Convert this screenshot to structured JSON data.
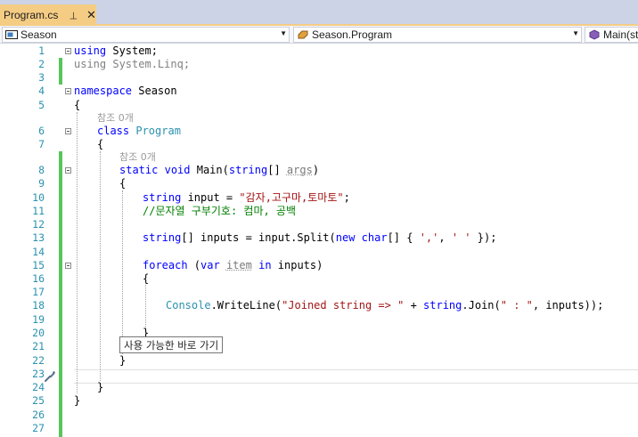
{
  "tab": {
    "title": "Program.cs",
    "pin_glyph": "⊣",
    "close_glyph": "✕",
    "active_color": "#f5cc84"
  },
  "navigation": {
    "project": "Season",
    "type": "Season.Program",
    "member": "Main(st"
  },
  "code_lens": {
    "references_0": "참조 0개"
  },
  "tooltip": "사용 가능한 바로 가기",
  "line_numbers": [
    "1",
    "2",
    "3",
    "4",
    "5",
    "6",
    "7",
    "8",
    "9",
    "10",
    "11",
    "12",
    "13",
    "14",
    "15",
    "16",
    "17",
    "18",
    "19",
    "20",
    "21",
    "22",
    "23",
    "24",
    "25",
    "26",
    "27"
  ],
  "code": {
    "l1_kw": "using",
    "l1_rest": " System;",
    "l2": "using System.Linq;",
    "l4_kw": "namespace",
    "l4_rest": " Season",
    "l5": "{",
    "l6_kw": "class",
    "l6_ty": "Program",
    "l7": "{",
    "l8_kw1": "static",
    "l8_kw2": "void",
    "l8_name": " Main(",
    "l8_kw3": "string",
    "l8_mid": "[] ",
    "l8_arg": "args",
    "l8_end": ")",
    "l9": "{",
    "l10_kw": "string",
    "l10_mid": " input = ",
    "l10_str": "\"감자,고구마,토마토\"",
    "l10_end": ";",
    "l11": "//문자열 구부기호: 컴마, 공백",
    "l13_kw": "string",
    "l13_a": "[] inputs = input.Split(",
    "l13_kw2": "new",
    "l13_sp": " ",
    "l13_kw3": "char",
    "l13_b": "[] { ",
    "l13_s1": "','",
    "l13_c": ", ",
    "l13_s2": "' '",
    "l13_d": " });",
    "l15_kw": "foreach",
    "l15_a": " (",
    "l15_kw2": "var",
    "l15_sp": " ",
    "l15_item": "item",
    "l15_sp2": " ",
    "l15_kw3": "in",
    "l15_b": " inputs)",
    "l16": "{",
    "l18_ty": "Console",
    "l18_a": ".WriteLine(",
    "l18_s1": "\"Joined string => \"",
    "l18_b": " + ",
    "l18_kw": "string",
    "l18_c": ".Join(",
    "l18_s2": "\" : \"",
    "l18_d": ", inputs));",
    "l20": "}",
    "l22": "}",
    "l24": "}",
    "l25": "}"
  },
  "colors": {
    "keyword": "#0000ff",
    "type": "#2b91af",
    "string": "#a31515",
    "comment": "#008000",
    "change_bar": "#57c65a"
  }
}
